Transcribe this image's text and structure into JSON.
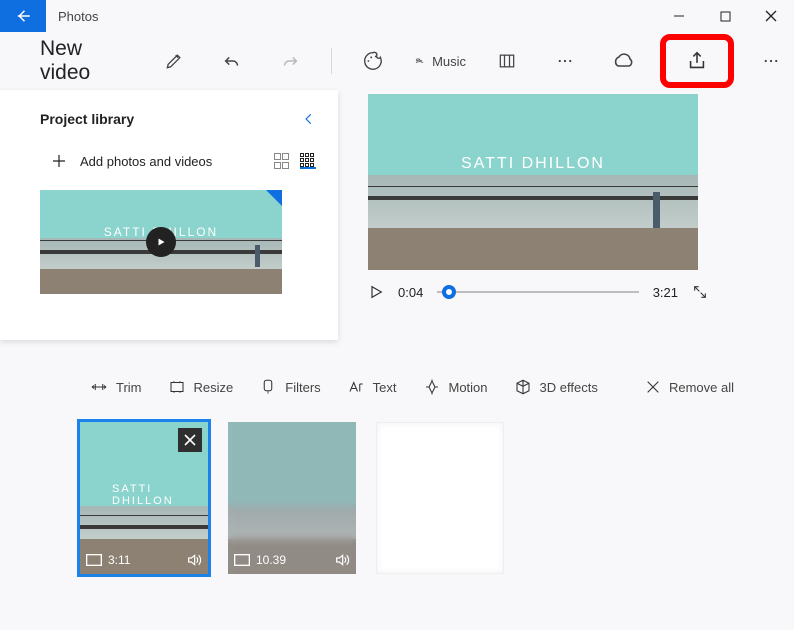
{
  "window": {
    "title": "Photos"
  },
  "header": {
    "project_title": "New video",
    "music_label": "Music"
  },
  "panel": {
    "title": "Project library",
    "add_label": "Add photos and videos",
    "thumb_caption": "SATTI DHILLON"
  },
  "preview": {
    "current_time": "0:04",
    "total_time": "3:21",
    "caption": "SATTI DHILLON"
  },
  "timeline": {
    "tools": {
      "trim": "Trim",
      "resize": "Resize",
      "filters": "Filters",
      "text": "Text",
      "motion": "Motion",
      "effects3d": "3D effects",
      "remove_all": "Remove all"
    },
    "clips": [
      {
        "duration": "3:11",
        "caption": "SATTI DHILLON",
        "selected": true,
        "blur": false
      },
      {
        "duration": "10.39",
        "caption": "",
        "selected": false,
        "blur": true
      }
    ]
  }
}
